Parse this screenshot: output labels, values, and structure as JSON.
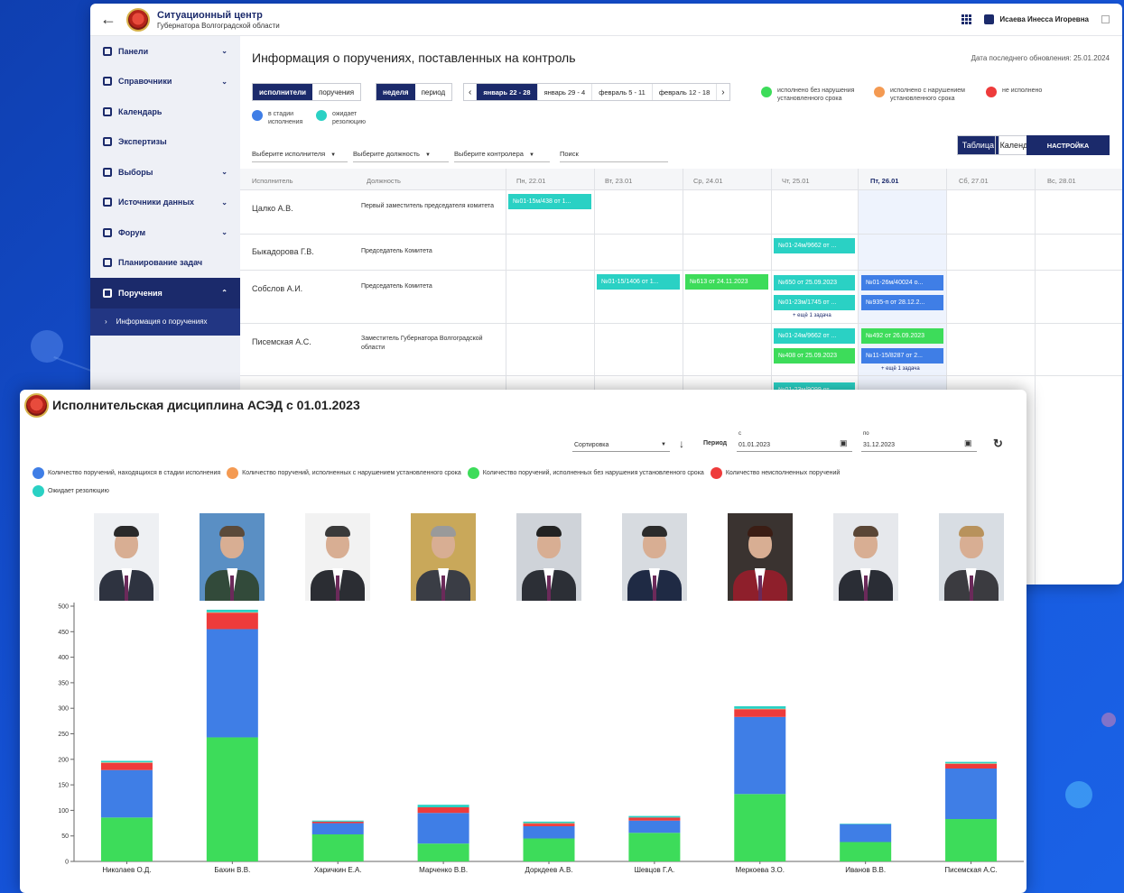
{
  "back": {
    "app_title": "Ситуационный центр",
    "app_subtitle": "Губернатора Волгоградской области",
    "user_name": "Исаева Инесса Игоревна",
    "sidebar": [
      {
        "label": "Панели",
        "chev": "⌄"
      },
      {
        "label": "Справочники",
        "chev": "⌄"
      },
      {
        "label": "Календарь",
        "chev": ""
      },
      {
        "label": "Экспертизы",
        "chev": ""
      },
      {
        "label": "Выборы",
        "chev": "⌄"
      },
      {
        "label": "Источники данных",
        "chev": "⌄"
      },
      {
        "label": "Форум",
        "chev": "⌄"
      },
      {
        "label": "Планирование задач",
        "chev": ""
      },
      {
        "label": "Поручения",
        "chev": "⌃"
      }
    ],
    "sidebar_sub": "Информация о поручениях",
    "page_title": "Информация о поручениях, поставленных на контроль",
    "last_update": "Дата последнего обновления: 25.01.2024",
    "seg_who": [
      "исполнители",
      "поручения"
    ],
    "seg_period": [
      "неделя",
      "период"
    ],
    "weeks": [
      "январь 22 - 28",
      "январь 29 - 4",
      "февраль 5 - 11",
      "февраль 12 - 18"
    ],
    "legend": [
      {
        "label": "исполнено без нарушения установленного срока",
        "color": "#3ddc5a"
      },
      {
        "label": "исполнено с нарушением установленного срока",
        "color": "#f49a52"
      },
      {
        "label": "не исполнено",
        "color": "#ee3b3b"
      },
      {
        "label": "в стадии исполнения",
        "color": "#3f7ee6"
      },
      {
        "label": "ожидает резолюцию",
        "color": "#2ad1c4"
      }
    ],
    "filters": [
      "Выберите исполнителя",
      "Выберите должность",
      "Выберите контролера",
      "Поиск"
    ],
    "view_table": "Таблица",
    "view_calendar": "Календарь",
    "settings_button": "НАСТРОЙКА",
    "col_executor": "Исполнитель",
    "col_position": "Должность",
    "days": [
      "Пн, 22.01",
      "Вт, 23.01",
      "Ср, 24.01",
      "Чт, 25.01",
      "Пт, 26.01",
      "Сб, 27.01",
      "Вс, 28.01"
    ],
    "rows": [
      {
        "name": "Цалко А.В.",
        "position": "Первый заместитель председателя комитета"
      },
      {
        "name": "Быкадорова Г.В.",
        "position": "Председатель Комитета"
      },
      {
        "name": "Собслов А.И.",
        "position": "Председатель Комитета"
      },
      {
        "name": "Писемская А.С.",
        "position": "Заместитель Губернатора Волгоградской области"
      }
    ],
    "tags": [
      {
        "text": "№01-15м/438 от 1...",
        "color": "#2ad1c4"
      },
      {
        "text": "№01-24м/9662 от ...",
        "color": "#2ad1c4"
      },
      {
        "text": "№01-15/1406 от 1...",
        "color": "#2ad1c4"
      },
      {
        "text": "№613 от 24.11.2023",
        "color": "#3ddc5a"
      },
      {
        "text": "№650 от 25.09.2023",
        "color": "#2ad1c4"
      },
      {
        "text": "№01-23м/1745 от ...",
        "color": "#2ad1c4"
      },
      {
        "text": "№01-26м/40024 о...",
        "color": "#3f7ee6"
      },
      {
        "text": "№935-п от 28.12.2...",
        "color": "#3f7ee6"
      },
      {
        "text": "№01-24м/9662 от ...",
        "color": "#2ad1c4"
      },
      {
        "text": "№408 от 25.09.2023",
        "color": "#3ddc5a"
      },
      {
        "text": "№492 от 26.09.2023",
        "color": "#3ddc5a"
      },
      {
        "text": "№11-15/8287 от 2...",
        "color": "#3f7ee6"
      },
      {
        "text": "№01-23м/9099 от ...",
        "color": "#2ad1c4"
      }
    ],
    "more_label": "+ ещё 1 задача"
  },
  "front": {
    "title": "Исполнительская дисциплина АСЭД с 01.01.2023",
    "sort_label": "Сортировка",
    "period_label": "Период",
    "date_from_label": "с",
    "date_from": "01.01.2023",
    "date_to_label": "по",
    "date_to": "31.12.2023",
    "legend": [
      {
        "label": "Количество поручений, находящихся в стадии исполнения",
        "color": "#3f7ee6"
      },
      {
        "label": "Количество поручений, исполненных с нарушением установленного срока",
        "color": "#f49a52"
      },
      {
        "label": "Количество поручений, исполненных без нарушения установленного срока",
        "color": "#3ddc5a"
      },
      {
        "label": "Количество неисполненных поручений",
        "color": "#ee3b3b"
      },
      {
        "label": "Ожидает резолюцию",
        "color": "#2ad1c4"
      }
    ]
  },
  "chart_data": {
    "type": "bar",
    "stacked": true,
    "categories": [
      "Николаев О.Д.",
      "Бахин В.В.",
      "Харичкин Е.А.",
      "Марченко В.В.",
      "Доркдеев А.В.",
      "Шевцов Г.А.",
      "Меркоева З.О.",
      "Иванов В.В.",
      "Писемская А.С."
    ],
    "ylim": [
      0,
      500
    ],
    "yticks": [
      0,
      50,
      100,
      150,
      200,
      250,
      300,
      350,
      400,
      450,
      500
    ],
    "series": [
      {
        "name": "Количество поручений, исполненных без нарушения установленного срока",
        "color": "#3ddc5a",
        "values": [
          86,
          243,
          53,
          35,
          45,
          56,
          132,
          38,
          83
        ]
      },
      {
        "name": "Количество поручений, находящихся в стадии исполнения",
        "color": "#3f7ee6",
        "values": [
          93,
          212,
          22,
          60,
          24,
          24,
          151,
          35,
          99
        ]
      },
      {
        "name": "Количество неисполненных поручений",
        "color": "#ee3b3b",
        "values": [
          14,
          32,
          3,
          11,
          5,
          6,
          15,
          0,
          9
        ]
      },
      {
        "name": "Количество поручений, исполненных с нарушением установленного срока",
        "color": "#f49a52",
        "values": [
          1,
          1,
          0,
          0,
          1,
          0,
          1,
          0,
          1
        ]
      },
      {
        "name": "Ожидает резолюцию",
        "color": "#2ad1c4",
        "values": [
          3,
          5,
          2,
          5,
          3,
          3,
          5,
          1,
          3
        ]
      }
    ]
  }
}
